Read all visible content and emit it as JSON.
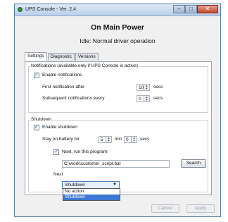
{
  "window": {
    "title": "UPS Console - Ver. 2.4",
    "controls": {
      "minimize": "–",
      "maximize": "□",
      "close": "✕"
    }
  },
  "header": {
    "title": "On Main Power",
    "status": "Idle: Normal driver operation"
  },
  "tabs": [
    {
      "label": "Settings",
      "active": true
    },
    {
      "label": "Diagnostic",
      "active": false
    },
    {
      "label": "Versions",
      "active": false
    }
  ],
  "notifications": {
    "group_label": "Notifications (available only if UPS Console is active)",
    "enable_label": "Enable notifications",
    "enable_checked": true,
    "first_label": "First notification after",
    "first_value": "10",
    "first_unit": "secs",
    "subsequent_label": "Subsequent notifications every",
    "subsequent_value": "0",
    "subsequent_unit": "secs"
  },
  "shutdown": {
    "group_label": "Shutdown",
    "enable_label": "Enable shutdown",
    "enable_checked": true,
    "stay_label": "Stay on battery for",
    "minutes_value": "5",
    "minutes_unit": "min",
    "seconds_value": "0",
    "seconds_unit": "secs",
    "run_program_label": "Next, run this program:",
    "run_program_checked": true,
    "program_path": "C:\\work\\customer_script.bat",
    "search_label": "Search",
    "next_label": "Next",
    "next_selected": "Shutdown",
    "next_options": [
      "No action",
      "Shutdown"
    ]
  },
  "footer": {
    "cancel_label": "Cancel",
    "apply_label": "Apply"
  },
  "colors": {
    "accent": "#3a78d4",
    "title_bar": "#b9d0ea",
    "close_button": "#c4452e"
  }
}
